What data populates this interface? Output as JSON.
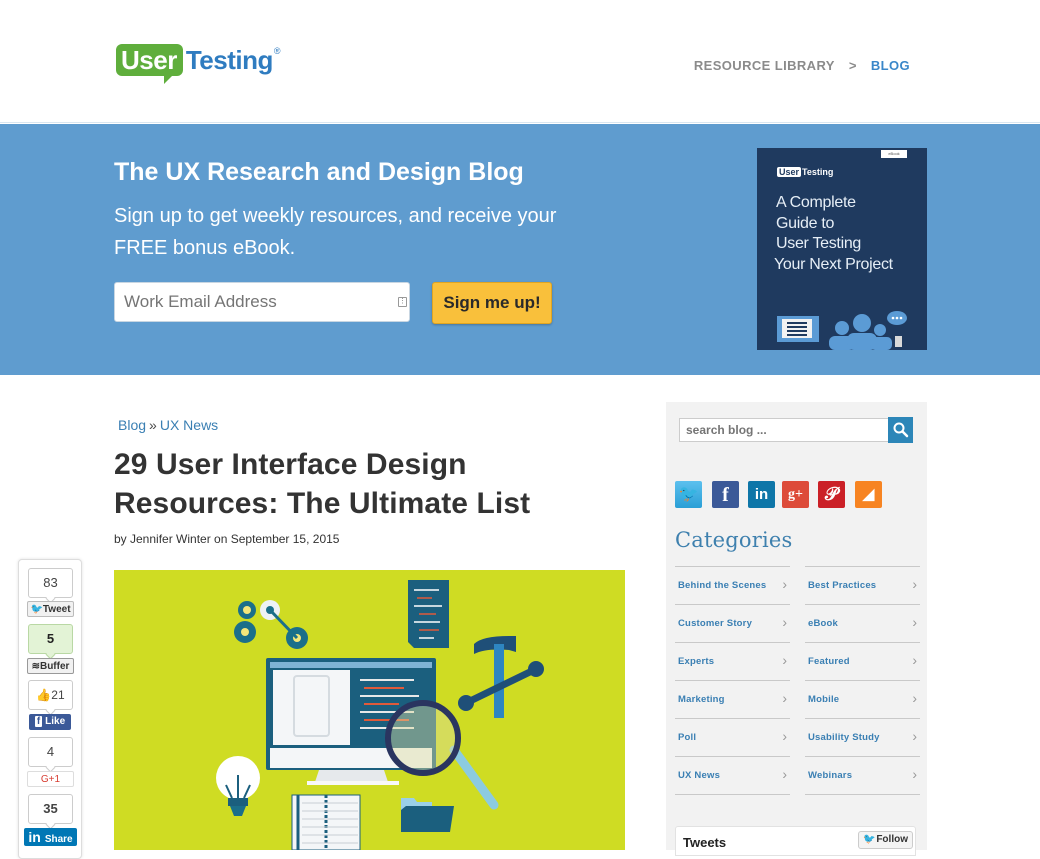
{
  "header": {
    "logo": {
      "part1": "User",
      "part2": "Testing",
      "reg": "®"
    },
    "nav": {
      "resource_library": "RESOURCE LIBRARY",
      "separator": ">",
      "blog": "BLOG"
    }
  },
  "hero": {
    "title": "The UX Research and Design Blog",
    "subtitle": "Sign up to get weekly resources, and receive your FREE bonus eBook.",
    "email_placeholder": "Work Email Address",
    "signup_label": "Sign me up!",
    "ebook": {
      "tag": "eBook",
      "logo_user": "User",
      "logo_testing": "Testing",
      "title_lines": [
        "A Complete",
        "Guide to",
        "User Testing",
        "Your Next Project"
      ]
    }
  },
  "article": {
    "breadcrumb": {
      "blog": "Blog",
      "separator": "»",
      "category": "UX News"
    },
    "title": "29 User Interface Design Resources: The Ultimate List",
    "byline": "by Jennifer Winter on September 15, 2015"
  },
  "share": {
    "twitter": {
      "count": "83",
      "label": "Tweet"
    },
    "buffer": {
      "count": "5",
      "label": "Buffer"
    },
    "facebook": {
      "count": "21",
      "label": "Like"
    },
    "gplus": {
      "count": "4",
      "label": "G+1"
    },
    "linkedin": {
      "count": "35",
      "label": "Share"
    }
  },
  "sidebar": {
    "search_placeholder": "search blog ...",
    "social_icons": [
      "twitter-icon",
      "facebook-icon",
      "linkedin-icon",
      "google-plus-icon",
      "pinterest-icon",
      "rss-icon"
    ],
    "categories_title": "Categories",
    "categories": [
      "Behind the Scenes",
      "Best Practices",
      "Customer Story",
      "eBook",
      "Experts",
      "Featured",
      "Marketing",
      "Mobile",
      "Poll",
      "Usability Study",
      "UX News",
      "Webinars"
    ],
    "tweets_title": "Tweets",
    "follow_label": "Follow"
  },
  "colors": {
    "hero_bg": "#5f9ccf",
    "signup": "#f9c03b",
    "link": "#3a7fb3",
    "logo_green": "#5fae3c",
    "logo_blue": "#2f7cc0",
    "image_bg": "#cfdc23"
  }
}
